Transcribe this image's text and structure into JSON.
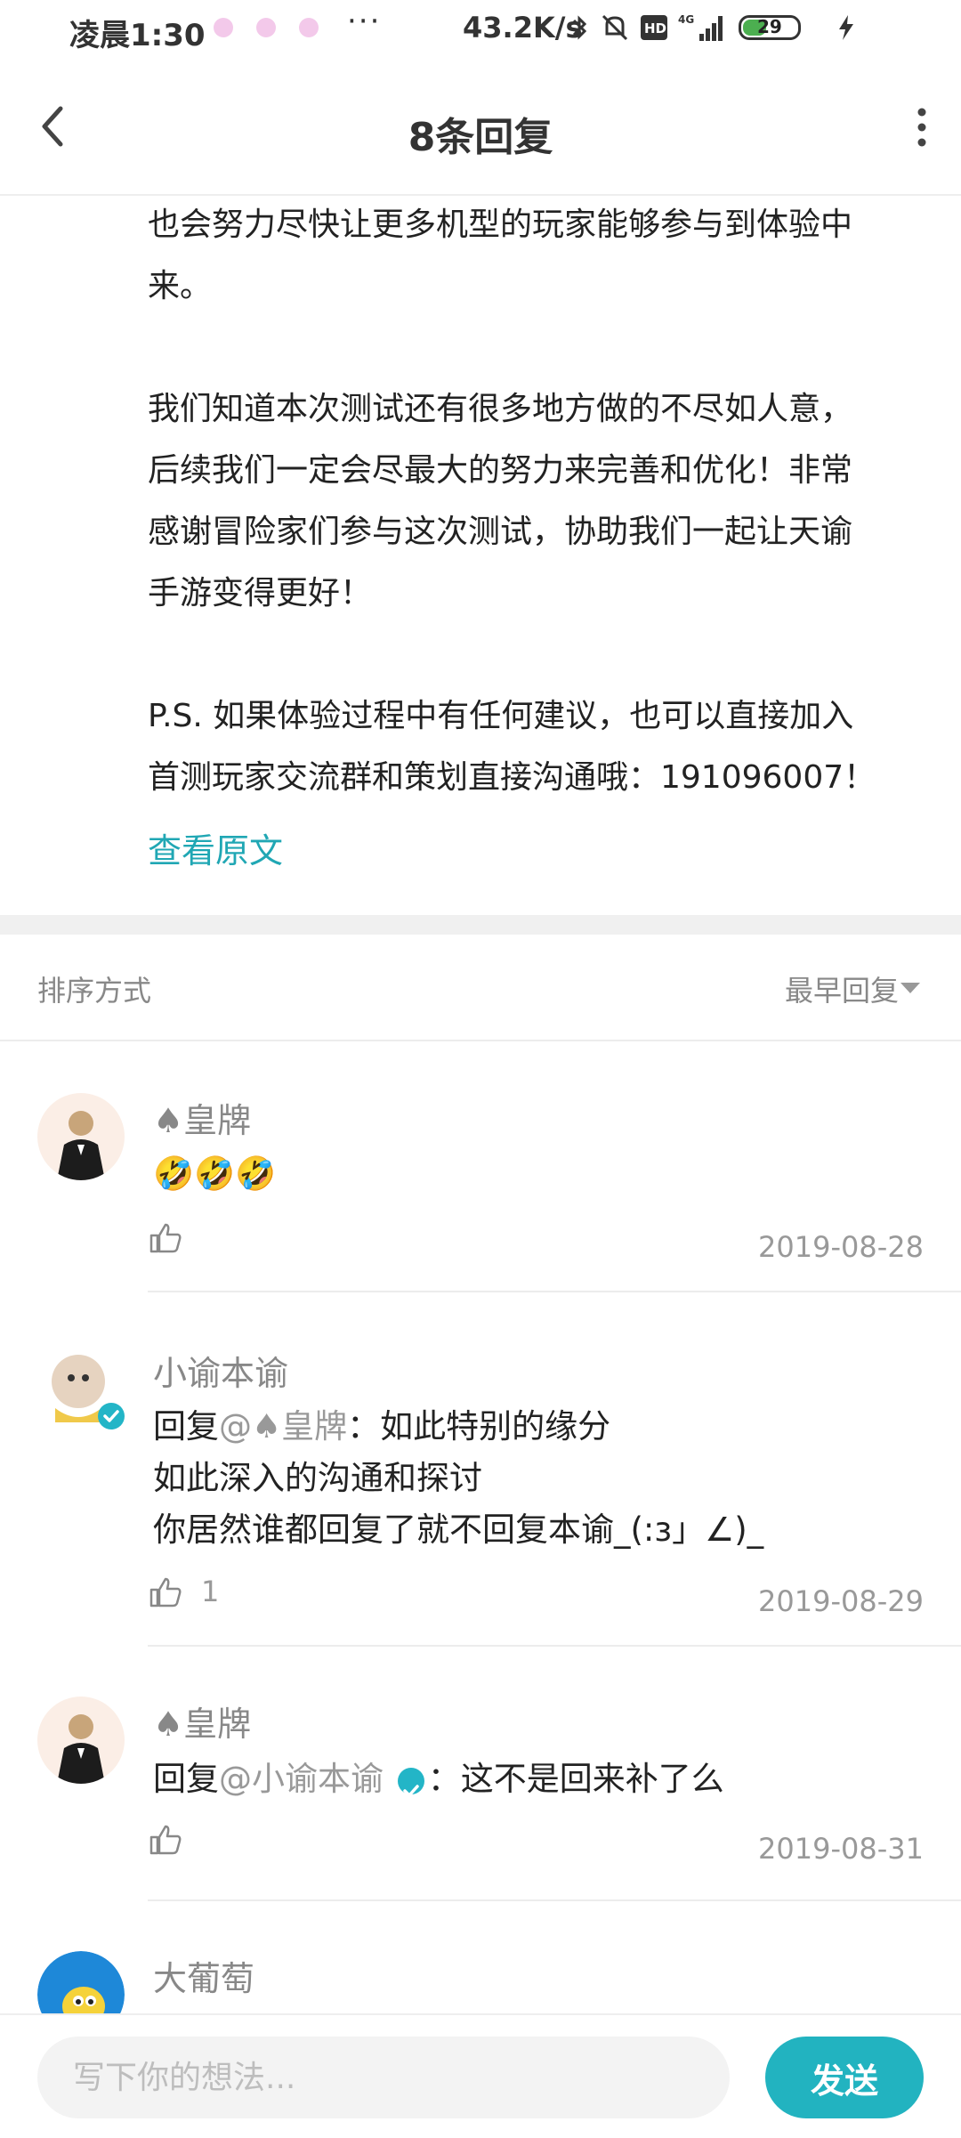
{
  "status_bar": {
    "time": "凌晨1:30",
    "more": "···",
    "speed": "43.2K/s",
    "network": "4G",
    "battery": "29",
    "icons": [
      "bluetooth-icon",
      "mute-icon",
      "hd-icon",
      "signal-icon",
      "battery-icon",
      "charging-icon"
    ]
  },
  "header": {
    "title": "8条回复",
    "back_icon": "chevron-left-icon",
    "menu_icon": "more-vertical-icon"
  },
  "article": {
    "para1_line1": "也会努力尽快让更多机型的玩家能够参与到体验中",
    "para1_line2": "来。",
    "para2_line1": "我们知道本次测试还有很多地方做的不尽如人意，",
    "para2_line2": "后续我们一定会尽最大的努力来完善和优化！非常",
    "para2_line3": "感谢冒险家们参与这次测试，协助我们一起让天谕",
    "para2_line4": "手游变得更好！",
    "para3_line1": "P.S. 如果体验过程中有任何建议，也可以直接加入",
    "para3_line2": "首测玩家交流群和策划直接沟通哦：191096007！",
    "view_original": "查看原文"
  },
  "sort": {
    "label": "排序方式",
    "value": "最早回复"
  },
  "comments": [
    {
      "name": "♠皇牌",
      "text": "🤣🤣🤣",
      "likes": "",
      "date": "2019-08-28"
    },
    {
      "name": "小谕本谕",
      "reply_prefix": "回复",
      "reply_to": "@♠皇牌",
      "line1": "：如此特别的缘分",
      "line2": "如此深入的沟通和探讨",
      "line3": "你居然谁都回复了就不回复本谕_(:з」∠)_",
      "likes": "1",
      "date": "2019-08-29"
    },
    {
      "name": "♠皇牌",
      "reply_prefix": "回复",
      "reply_to": "@小谕本谕",
      "line1": "：这不是回来补了么",
      "likes": "",
      "date": "2019-08-31"
    },
    {
      "name": "大葡萄"
    }
  ],
  "composer": {
    "placeholder": "写下你的想法...",
    "send_label": "发送"
  },
  "colors": {
    "accent": "#22b3c0",
    "link": "#20a7b4",
    "muted": "#999999"
  }
}
